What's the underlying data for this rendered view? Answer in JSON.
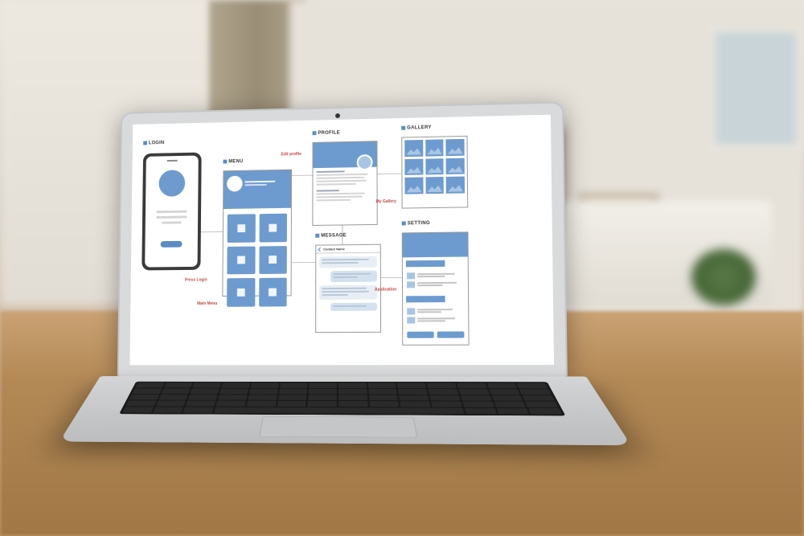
{
  "screens": {
    "login": {
      "label": "LOGIN"
    },
    "menu": {
      "label": "MENU"
    },
    "profile": {
      "label": "PROFILE"
    },
    "gallery": {
      "label": "GALLERY"
    },
    "message": {
      "label": "MESSAGE",
      "header": "Contact Name"
    },
    "setting": {
      "label": "SETTING"
    }
  },
  "annotations": {
    "press_login": "Press Login",
    "main_menu": "Main Menu",
    "edit_profile": "Edit profile",
    "my_gallery": "My Gallery",
    "application": "Application"
  }
}
